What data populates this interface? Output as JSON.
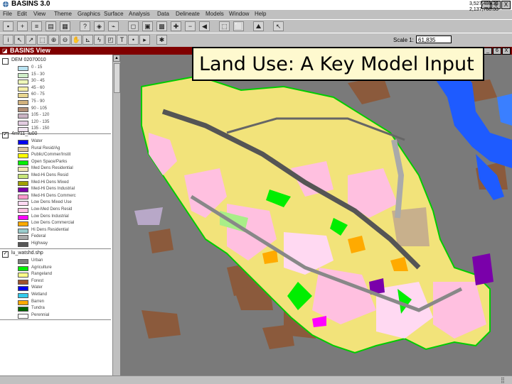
{
  "app": {
    "title": "BASINS 3.0"
  },
  "window_buttons": [
    "_",
    "6",
    "X"
  ],
  "menu": [
    "File",
    "Edit",
    "View",
    "Theme",
    "Graphics",
    "Surface",
    "Analysis",
    "Data",
    "Delineate",
    "Models",
    "Window",
    "Help"
  ],
  "scale": {
    "label": "Scale 1:",
    "value": "61,835"
  },
  "coords": {
    "x": "3,527,486.33",
    "y": "2,137,760.33"
  },
  "view": {
    "title": "BASINS View"
  },
  "overlay": {
    "text": "Land Use:  A Key Model Input"
  },
  "toc": {
    "dem": {
      "name": "DEM 02070010",
      "items": [
        {
          "label": "0 - 15",
          "color": "#b9e3f2"
        },
        {
          "label": "15 - 30",
          "color": "#cfeec9"
        },
        {
          "label": "30 - 45",
          "color": "#eef7b8"
        },
        {
          "label": "45 - 60",
          "color": "#f6f0a8"
        },
        {
          "label": "60 - 75",
          "color": "#e8d690"
        },
        {
          "label": "75 - 90",
          "color": "#d2b27e"
        },
        {
          "label": "90 - 105",
          "color": "#b29078"
        },
        {
          "label": "105 - 120",
          "color": "#c9b2c2"
        },
        {
          "label": "120 - 135",
          "color": "#e2cbe0"
        },
        {
          "label": "135 - 150",
          "color": "#f0e4f0"
        }
      ]
    },
    "landuse": {
      "name": "4mr11_lu00",
      "items": [
        {
          "label": "Water",
          "color": "#0000ee"
        },
        {
          "label": "Rural Resid/Ag",
          "color": "#dcc3a0"
        },
        {
          "label": "Public/Commer/Instit",
          "color": "#ffff00"
        },
        {
          "label": "Open Space/Parks",
          "color": "#00ee00"
        },
        {
          "label": "Med Dens Residential",
          "color": "#f2e6b0"
        },
        {
          "label": "Med-Hi Dens Resid",
          "color": "#c8e67a"
        },
        {
          "label": "Med-Hi Dens Mixed",
          "color": "#a0a000"
        },
        {
          "label": "Med-Hi Dens Industrial",
          "color": "#7a00aa"
        },
        {
          "label": "Med-Hi Dens Commerc",
          "color": "#ff99cc"
        },
        {
          "label": "Low Dens Mixed Use",
          "color": "#ffd9f2"
        },
        {
          "label": "Low-Med Dens Resid",
          "color": "#ffc0e0"
        },
        {
          "label": "Low Dens Industrial",
          "color": "#ff00ff"
        },
        {
          "label": "Low Dens Commercial",
          "color": "#ffaa00"
        },
        {
          "label": "Hi Dens Residential",
          "color": "#99cccc"
        },
        {
          "label": "Federal",
          "color": "#aaaaaa"
        },
        {
          "label": "Highway",
          "color": "#555555"
        }
      ]
    },
    "watershed": {
      "name": "lu_watshd.shp",
      "items": [
        {
          "label": "Urban",
          "color": "#7f7f7f"
        },
        {
          "label": "Agriculture",
          "color": "#00ee00"
        },
        {
          "label": "Rangeland",
          "color": "#ffff88"
        },
        {
          "label": "Forest",
          "color": "#a0522d"
        },
        {
          "label": "Water",
          "color": "#0000ee"
        },
        {
          "label": "Wetland",
          "color": "#33ccee"
        },
        {
          "label": "Barren",
          "color": "#ffaa00"
        },
        {
          "label": "Tundra",
          "color": "#006400"
        },
        {
          "label": "Perennial",
          "color": "#ffffff"
        }
      ]
    }
  }
}
